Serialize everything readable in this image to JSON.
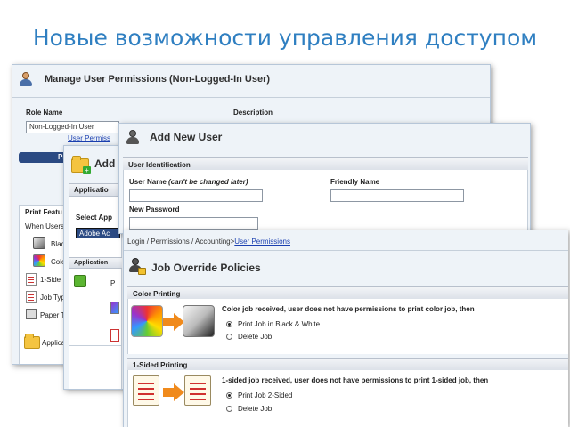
{
  "slide": {
    "title": "Новые возможности управления доступом"
  },
  "win1": {
    "title": "Manage User Permissions (Non-Logged-In User)",
    "role_label": "Role Name",
    "role_value": "Non-Logged-In User",
    "description_label": "Description",
    "user_perm_link": "User Permiss",
    "print_tab": "Prin",
    "print_features_label": "Print Featu",
    "when_users_label": "When Users",
    "items": [
      "Blac",
      "Colo",
      "1-Side",
      "Job Typ",
      "Paper T",
      "Applica"
    ]
  },
  "win2": {
    "title": "Add",
    "app_section": "Applicatio",
    "select_app_label": "Select App",
    "select_value": "Adobe Ac",
    "app_section2": "Application",
    "r_letter": "P"
  },
  "win3": {
    "title": "Add New User",
    "section": "User Identification",
    "username_label": "User Name",
    "username_note": "(can't be changed later)",
    "friendly_name_label": "Friendly Name",
    "password_label": "New Password"
  },
  "win4": {
    "breadcrumb_prefix": "Login / Permissions / Accounting>",
    "breadcrumb_link": "User Permissions",
    "title": "Job Override Policies",
    "color": {
      "section": "Color Printing",
      "message": "Color job received, user does not have permissions to print color job, then",
      "options": [
        "Print Job in Black & White",
        "Delete Job"
      ]
    },
    "sided": {
      "section": "1-Sided Printing",
      "message": "1-sided job received, user does not have permissions to print 1-sided job, then",
      "options": [
        "Print Job 2-Sided",
        "Delete Job"
      ]
    }
  }
}
